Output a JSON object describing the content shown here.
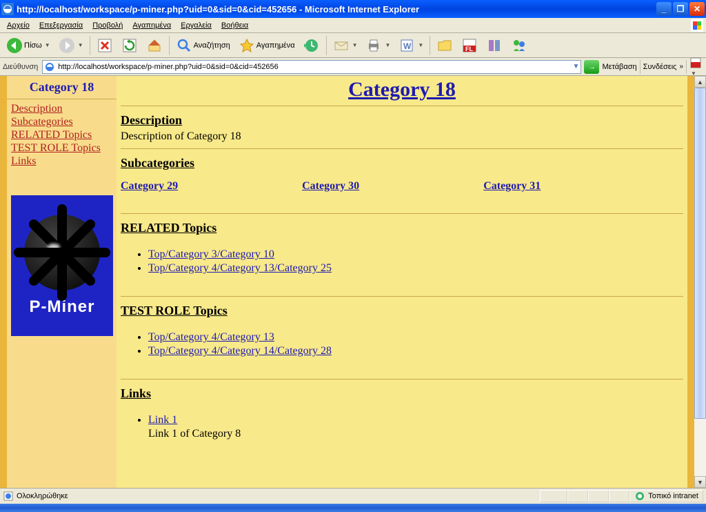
{
  "window": {
    "title": "http://localhost/workspace/p-miner.php?uid=0&sid=0&cid=452656 - Microsoft Internet Explorer"
  },
  "menu": {
    "file": "Αρχείο",
    "edit": "Επεξεργασία",
    "view": "Προβολή",
    "fav": "Αγαπημένα",
    "tools": "Εργαλεία",
    "help": "Βοήθεια"
  },
  "toolbar": {
    "back": "Πίσω",
    "search": "Αναζήτηση",
    "favorites": "Αγαπημένα"
  },
  "addressbar": {
    "label": "Διεύθυνση",
    "url": "http://localhost/workspace/p-miner.php?uid=0&sid=0&cid=452656",
    "go": "Μετάβαση",
    "links": "Συνδέσεις"
  },
  "content": {
    "sidebar_title": "Category 18",
    "nav": {
      "desc": "Description",
      "sub": "Subcategories",
      "rel": "RELATED Topics",
      "test": "TEST ROLE Topics",
      "links": "Links"
    },
    "logo_text": "P-Miner",
    "page_title": "Category 18",
    "sections": {
      "desc_h": "Description",
      "desc_t": "Description of Category 18",
      "sub_h": "Subcategories",
      "subs": {
        "a": "Category 29",
        "b": "Category 30",
        "c": "Category 31"
      },
      "rel_h": "RELATED Topics",
      "rel": {
        "a": "Top/Category 3/Category 10",
        "b": "Top/Category 4/Category 13/Category 25"
      },
      "test_h": "TEST ROLE Topics",
      "test": {
        "a": "Top/Category 4/Category 13",
        "b": "Top/Category 4/Category 14/Category 28"
      },
      "links_h": "Links",
      "link1": "Link 1",
      "link1_t": "Link 1 of Category 8"
    }
  },
  "status": {
    "done": "Ολοκληρώθηκε",
    "zone": "Τοπικό intranet"
  }
}
